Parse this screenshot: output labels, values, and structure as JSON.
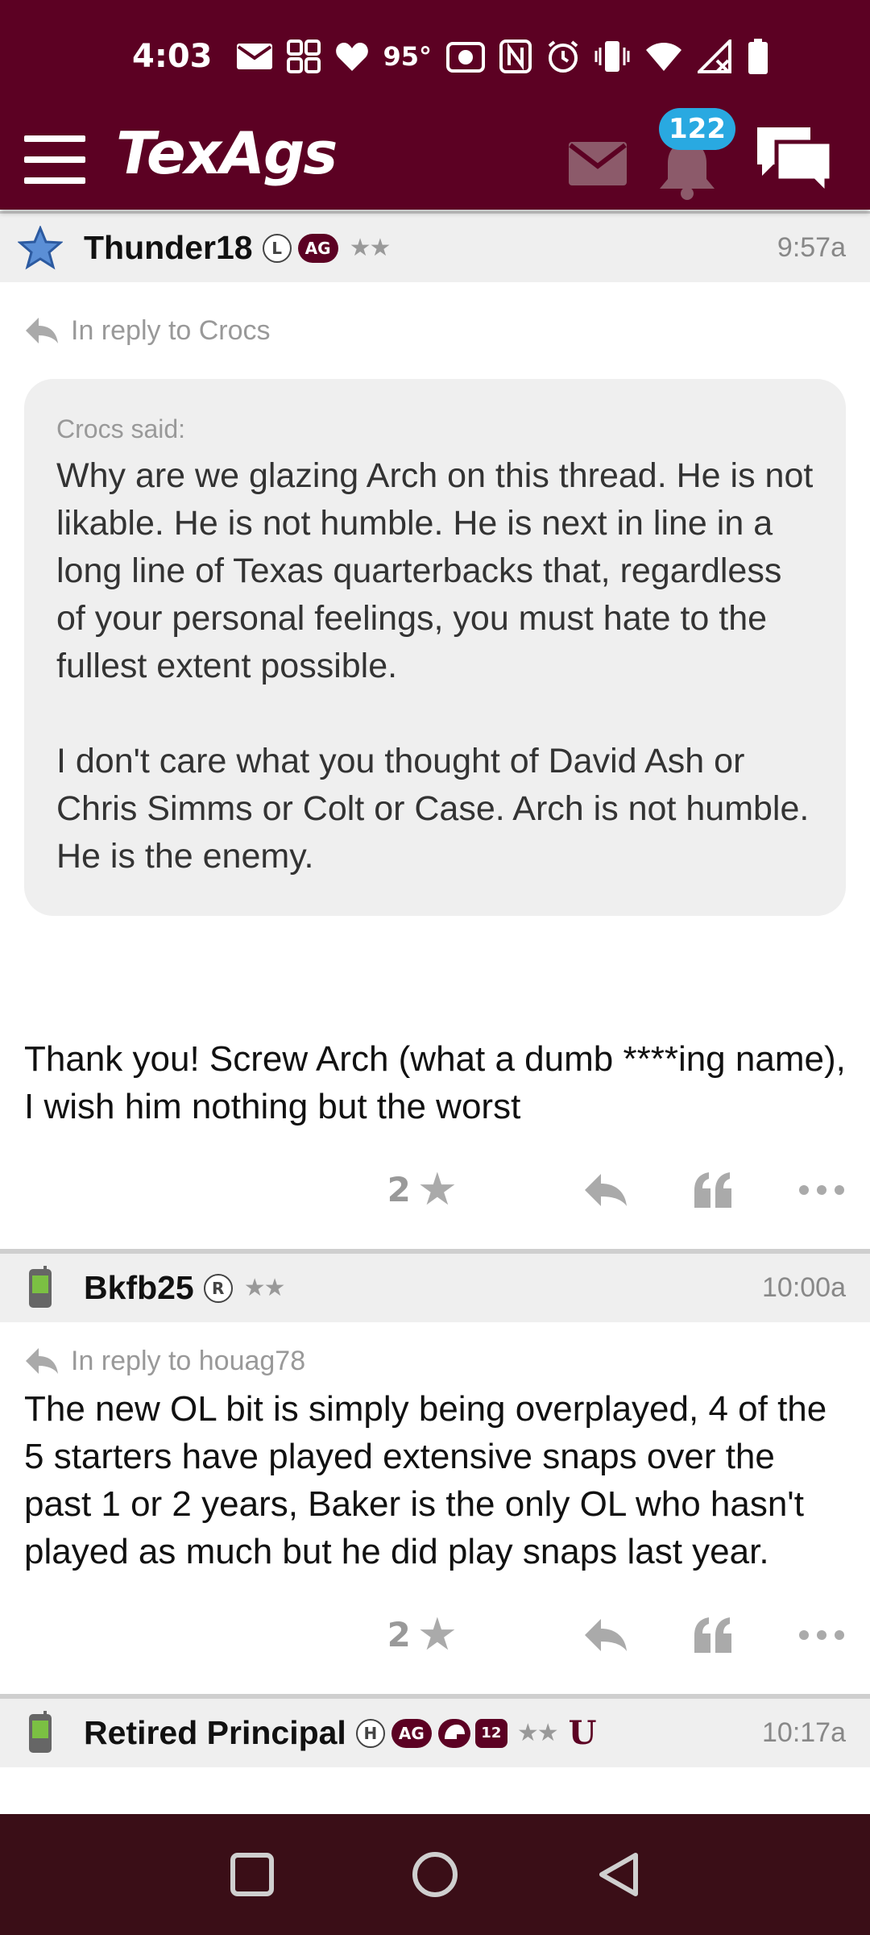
{
  "status_bar": {
    "time": "4:03",
    "temperature": "95°"
  },
  "header": {
    "logo": "TexAgs",
    "notification_count": "122"
  },
  "posts": [
    {
      "username": "Thunder18",
      "badges": [
        "L",
        "AG"
      ],
      "rating": "★★",
      "timestamp": "9:57a",
      "reply_to": "In reply to Crocs",
      "quote": {
        "attribution": "Crocs said:",
        "paragraphs": [
          "Why are we glazing Arch on this thread. He is not likable. He is not humble. He is next in line in a long line of Texas quarterbacks that, regardless of your personal feelings, you must hate to the fullest extent possible.",
          "I don't care what you thought of David Ash or Chris Simms or Colt or Case. Arch is not humble. He is the enemy."
        ]
      },
      "body": "Thank you! Screw Arch (what a dumb ****ing name), I wish him nothing but the worst",
      "star_count": "2"
    },
    {
      "username": "Bkfb25",
      "badges": [
        "R"
      ],
      "rating": "★★",
      "timestamp": "10:00a",
      "reply_to": "In reply to houag78",
      "body": "The new OL bit is simply being overplayed, 4 of the 5 starters have played extensive snaps over the past 1 or 2 years, Baker is the only OL who hasn't played as much but he did play snaps last year.",
      "star_count": "2"
    },
    {
      "username": "Retired Principal",
      "badges": [
        "H",
        "AG",
        "12"
      ],
      "rating": "★★",
      "timestamp": "10:17a"
    }
  ],
  "colors": {
    "brand": "#5c0123",
    "badge_blue": "#29a9e1",
    "nav_bg": "#3a0e17"
  }
}
